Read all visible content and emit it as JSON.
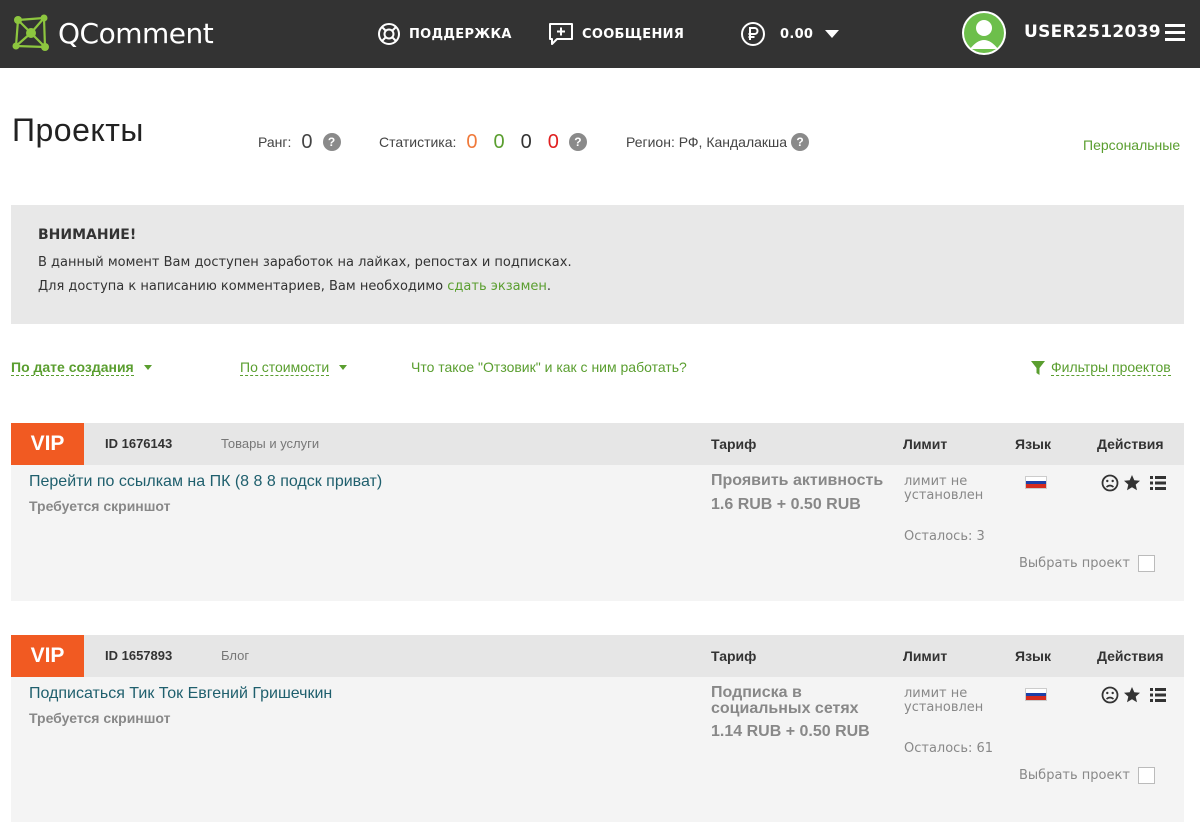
{
  "header": {
    "logo_text": "QComment",
    "support_label": "ПОДДЕРЖКА",
    "messages_label": "СООБЩЕНИЯ",
    "balance_value": "0.00",
    "username": "USER2512039"
  },
  "page": {
    "title": "Проекты",
    "rank_label": "Ранг:",
    "rank_value": "0",
    "stats_label": "Статистика:",
    "stats_values": [
      "0",
      "0",
      "0",
      "0"
    ],
    "stats_colors": [
      "#f07a3b",
      "#5a9e2f",
      "#333333",
      "#e02020"
    ],
    "region_label": "Регион: РФ, Кандалакша",
    "personal_link": "Персональные"
  },
  "notice": {
    "title": "ВНИМАНИЕ!",
    "line1": "В данный момент Вам доступен заработок на лайках, репостах и подписках.",
    "line2_prefix": "Для доступа к написанию комментариев, Вам необходимо ",
    "line2_link": "сдать экзамен",
    "line2_suffix": "."
  },
  "sort": {
    "by_date": "По дате создания",
    "by_price": "По стоимости",
    "about": "Что такое \"Отзовик\" и как с ним работать?",
    "filters": "Фильтры проектов"
  },
  "columns": {
    "tariff": "Тариф",
    "limit": "Лимит",
    "lang": "Язык",
    "actions": "Действия"
  },
  "projects": [
    {
      "badge": "VIP",
      "id": "ID 1676143",
      "category": "Товары и услуги",
      "title": "Перейти по ссылкам на ПК (8 8 8 подск приват)",
      "subtitle": "Требуется скриншот",
      "tariff_name": "Проявить активность",
      "tariff_price": "1.6 RUB + 0.50 RUB",
      "limit": "лимит не установлен",
      "remaining": "Осталось: 3",
      "select_label": "Выбрать проект"
    },
    {
      "badge": "VIP",
      "id": "ID 1657893",
      "category": "Блог",
      "title": "Подписаться Тик Ток Евгений Гришечкин",
      "subtitle": "Требуется скриншот",
      "tariff_name": "Подписка в социальных сетях",
      "tariff_price": "1.14 RUB + 0.50 RUB",
      "limit": "лимит не установлен",
      "remaining": "Осталось: 61",
      "select_label": "Выбрать проект"
    }
  ],
  "colors": {
    "accent_green": "#5a9e2f",
    "vip_orange": "#f15a22",
    "header_bg": "#333333"
  }
}
